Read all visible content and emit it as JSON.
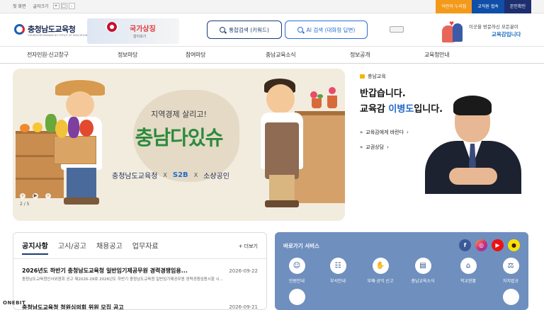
{
  "util": {
    "home": "첫 화면",
    "font_size": "글자크기",
    "zoom_in": "+",
    "zoom_reset": "□",
    "zoom_out": "-",
    "kid_site": "어린이 누리집",
    "staff_login": "교직원 접속",
    "verify": "본인확인"
  },
  "header": {
    "logo_text": "충청남도교육청",
    "logo_sub": "CHUNGCHEONGNAM-DO OFFICE OF EDUCATION",
    "banner_title": "국가상징",
    "banner_sub": "알아보기",
    "search_label": "통합검색 (키워드)",
    "ai_search_label": "AI 검색 (대화형 답변)",
    "visit_text": "이곳을 방문하신 모든분이",
    "visit_highlight": "교육감입니다"
  },
  "nav": [
    "전자민원·신고창구",
    "정보마당",
    "참여마당",
    "충남교육소식",
    "정보공개",
    "교육청안내"
  ],
  "visual": {
    "subtitle": "지역경제 살리고!",
    "title": "충남다있슈",
    "partner1": "충청남도교육청",
    "x1": "X",
    "partner2": "S2B",
    "x2": "X",
    "partner3": "소상공인",
    "pager": "2 / 5"
  },
  "greeting": {
    "label": "충남교육",
    "line1": "반갑습니다.",
    "line2_prefix": "교육감 ",
    "line2_name": "이병도",
    "line2_suffix": "입니다.",
    "link1": "교육감에게 바란다",
    "link2": "교권상담"
  },
  "notice": {
    "tabs": [
      "공지사항",
      "고시/공고",
      "채용공고",
      "업무자료"
    ],
    "more": "+ 더보기",
    "items": [
      {
        "title": "2026년도 하반기 충청남도교육청 일반임기제공무원 경력경쟁임용...",
        "date": "2026-09-22",
        "summary": "충청남도교육청인사위원회 공고 제2026-29호 2026년도 하반기 충청남도교육청 일반임기제공무원 경력경쟁임용시험 시..."
      },
      {
        "title": "충청남도교육청 청원심의회 위원 모집 공고",
        "date": "2026-09-21"
      }
    ]
  },
  "quick": {
    "title": "바로가기 서비스",
    "items": [
      "민원안내",
      "부서안내",
      "부패·공익 신고",
      "충남교육소식",
      "학교현황",
      "자치법규"
    ]
  },
  "watermark": "ONEBIT"
}
